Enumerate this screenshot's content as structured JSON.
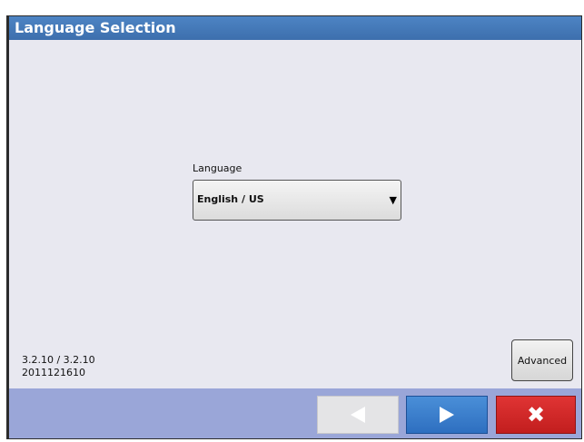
{
  "window": {
    "title": "Language Selection"
  },
  "language": {
    "label": "Language",
    "selected": "English / US"
  },
  "version": {
    "line1": "3.2.10 / 3.2.10",
    "line2": "2011121610"
  },
  "buttons": {
    "advanced_label": "Advanced",
    "back_icon": "left-triangle-icon",
    "next_icon": "right-triangle-icon",
    "cancel_icon": "close-x-icon",
    "cancel_glyph": "✖"
  },
  "colors": {
    "title_bar": "#4176b8",
    "content_bg": "#e8e8f0",
    "bottom_bar": "#9aa6d8",
    "next_button": "#3a7fcf",
    "cancel_button": "#d22a2a",
    "back_button_disabled": "#e4e4e6"
  }
}
